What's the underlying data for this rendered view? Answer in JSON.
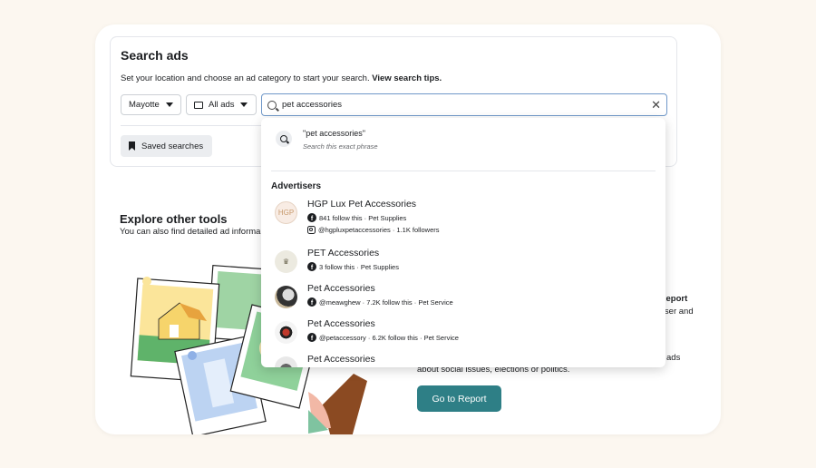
{
  "search": {
    "title": "Search ads",
    "subtitle": "Set your location and choose an ad category to start your search. ",
    "tips_link": "View search tips.",
    "location": "Mayotte",
    "category": "All ads",
    "query": "pet accessories",
    "saved_label": "Saved searches"
  },
  "explore": {
    "title": "Explore other tools",
    "subtitle": "You can also find detailed ad informa"
  },
  "report": {
    "heading_fragment": "ry Report",
    "line1_fragment": "rtiser and",
    "line2_fragment": "ads",
    "line3": "about social issues, elections or politics.",
    "button": "Go to Report"
  },
  "dropdown": {
    "phrase": "\"pet accessories\"",
    "phrase_note": "Search this exact phrase",
    "advertisers_heading": "Advertisers",
    "advertisers": [
      {
        "name": "HGP Lux Pet Accessories",
        "fb": "841 follow this · Pet Supplies",
        "ig": "@hgpluxpetaccessories · 1.1K followers",
        "avatar_text": "HGP"
      },
      {
        "name": "PET Accessories",
        "fb": "3 follow this · Pet Supplies",
        "avatar_text": "♛"
      },
      {
        "name": "Pet Accessories",
        "fb": "@meawghew · 7.2K follow this · Pet Service",
        "avatar_text": ""
      },
      {
        "name": "Pet Accessories",
        "fb": "@petaccessory · 6.2K follow this · Pet Service",
        "avatar_text": ""
      },
      {
        "name": "Pet Accessories",
        "fb": "",
        "avatar_text": ""
      }
    ]
  },
  "icons": {
    "search": "search-icon",
    "clear": "close-icon",
    "bookmark": "bookmark-icon",
    "facebook": "facebook-icon",
    "instagram": "instagram-icon"
  },
  "colors": {
    "accent": "#2e7f86",
    "focus_border": "#6f98c9",
    "background": "#fcf7f0"
  }
}
